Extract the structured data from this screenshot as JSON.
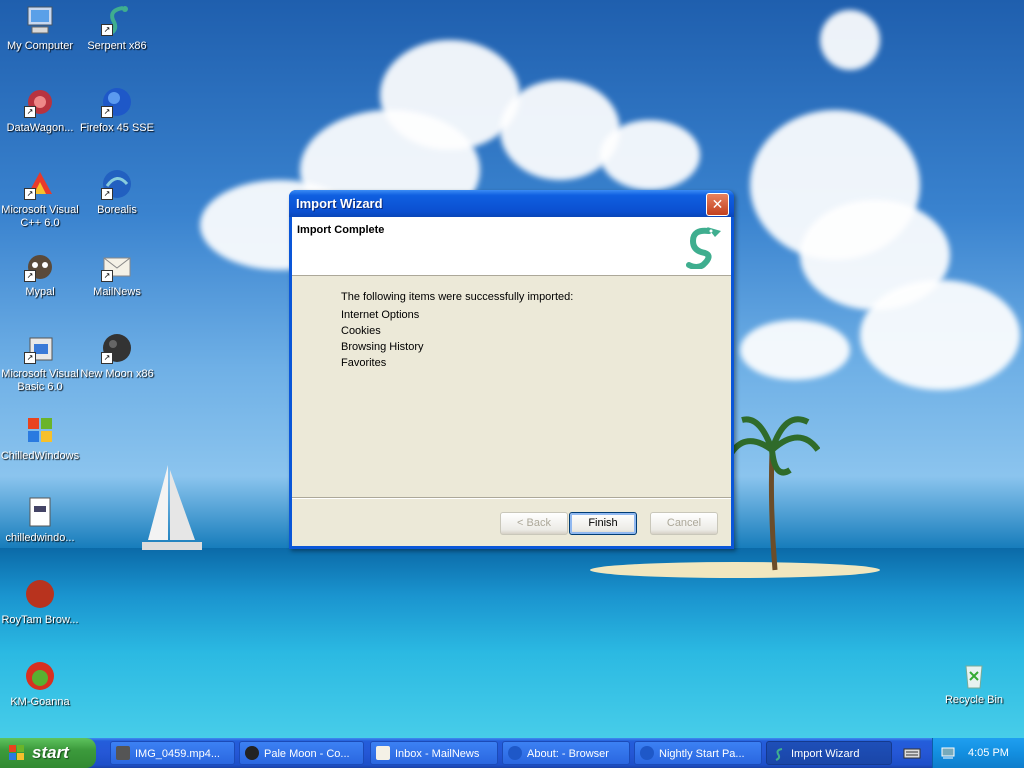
{
  "desktop": {
    "icons": [
      {
        "label": "My Computer"
      },
      {
        "label": "Serpent x86"
      },
      {
        "label": "DataWagon..."
      },
      {
        "label": "Firefox 45 SSE"
      },
      {
        "label": "Microsoft Visual C++ 6.0"
      },
      {
        "label": "Borealis"
      },
      {
        "label": "Mypal"
      },
      {
        "label": "MailNews"
      },
      {
        "label": "Microsoft Visual Basic 6.0"
      },
      {
        "label": "New Moon x86"
      },
      {
        "label": "ChilledWindows"
      },
      {
        "label": "chilledwindo..."
      },
      {
        "label": "RoyTam Brow..."
      },
      {
        "label": "KM-Goanna"
      },
      {
        "label": "Recycle Bin"
      }
    ]
  },
  "dialog": {
    "title": "Import Wizard",
    "close_label": "✕",
    "header_title": "Import Complete",
    "intro": "The following items were successfully imported:",
    "items": [
      "Internet Options",
      "Cookies",
      "Browsing History",
      "Favorites"
    ],
    "buttons": {
      "back": "< Back",
      "finish": "Finish",
      "cancel": "Cancel"
    }
  },
  "taskbar": {
    "start_label": "start",
    "tasks": [
      {
        "label": "IMG_0459.mp4..."
      },
      {
        "label": "Pale Moon - Co..."
      },
      {
        "label": "Inbox - MailNews"
      },
      {
        "label": "About: - Browser"
      },
      {
        "label": "Nightly Start Pa..."
      },
      {
        "label": "Import Wizard"
      }
    ],
    "clock": "4:05 PM"
  },
  "colors": {
    "titlebar": "#0b4fd0",
    "taskbar": "#2557d6",
    "start": "#3c9a3c",
    "serpent_green": "#3fae8f"
  }
}
